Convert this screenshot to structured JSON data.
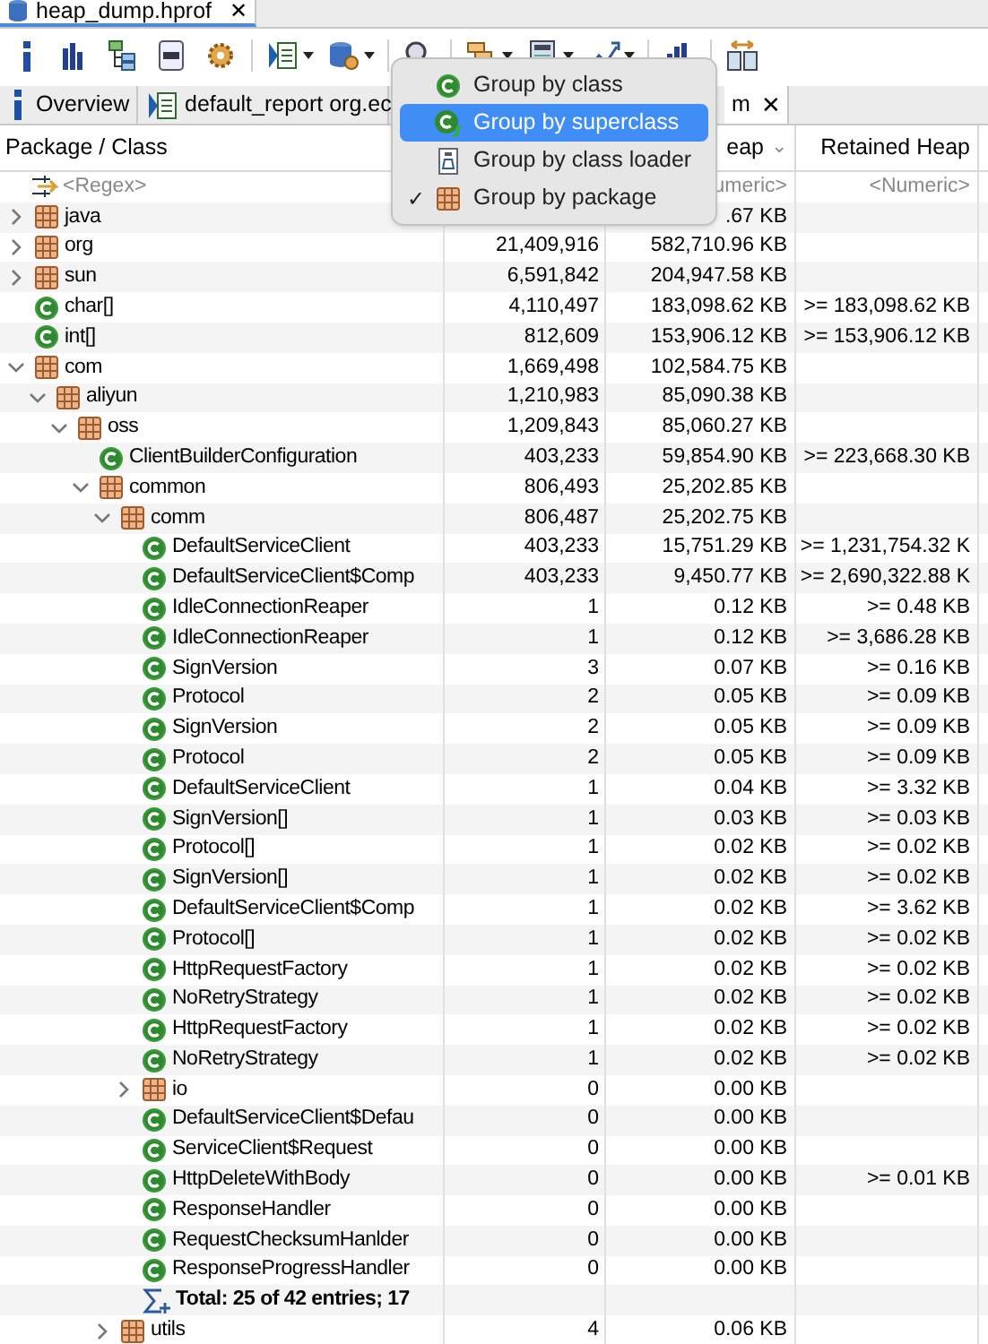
{
  "editor_tab": {
    "title": "heap_dump.hprof",
    "close": "✕"
  },
  "toolbar": [
    {
      "kind": "info",
      "dropdown": false
    },
    {
      "kind": "histogram",
      "dropdown": false
    },
    {
      "kind": "tree",
      "dropdown": false
    },
    {
      "kind": "oql",
      "dropdown": false
    },
    {
      "kind": "gears",
      "dropdown": false
    },
    {
      "kind": "report",
      "dropdown": true
    },
    {
      "kind": "dbgear",
      "dropdown": true
    },
    {
      "kind": "search",
      "dropdown": false
    },
    {
      "kind": "group",
      "dropdown": true
    },
    {
      "kind": "calc",
      "dropdown": true
    },
    {
      "kind": "export",
      "dropdown": true
    },
    {
      "kind": "chart",
      "dropdown": false
    },
    {
      "kind": "compare",
      "dropdown": false
    }
  ],
  "tabs": [
    {
      "kind": "info",
      "label": "Overview",
      "selected": false
    },
    {
      "kind": "report",
      "label": "default_report org.ec",
      "selected": false
    },
    {
      "kind": "none",
      "label": "m",
      "selected": true,
      "close": "✕"
    }
  ],
  "columns": [
    {
      "label": "Package / Class"
    },
    {
      "label": "eap",
      "sort": "⌄"
    },
    {
      "label": "Retained Heap"
    }
  ],
  "filter": {
    "name": "<Regex>",
    "shallow": "umeric>",
    "retained": "<Numeric>"
  },
  "rows": [
    {
      "kind": "package",
      "name": "java",
      "expanded": false,
      "shallow": ".67 KB"
    },
    {
      "kind": "package",
      "name": "org",
      "expanded": false,
      "objects": "21,409,916",
      "shallow": "582,710.96 KB"
    },
    {
      "kind": "package",
      "name": "sun",
      "expanded": false,
      "objects": "6,591,842",
      "shallow": "204,947.58 KB"
    },
    {
      "kind": "class",
      "name": "char[]",
      "objects": "4,110,497",
      "shallow": "183,098.62 KB",
      "retained": ">= 183,098.62 KB"
    },
    {
      "kind": "class",
      "name": "int[]",
      "objects": "812,609",
      "shallow": "153,906.12 KB",
      "retained": ">= 153,906.12 KB"
    },
    {
      "kind": "package",
      "name": "com",
      "expanded": true,
      "objects": "1,669,498",
      "shallow": "102,584.75 KB",
      "children": [
        {
          "kind": "package",
          "name": "aliyun",
          "expanded": true,
          "objects": "1,210,983",
          "shallow": "85,090.38 KB",
          "children": [
            {
              "kind": "package",
              "name": "oss",
              "expanded": true,
              "objects": "1,209,843",
              "shallow": "85,060.27 KB",
              "children": [
                {
                  "kind": "class",
                  "name": "ClientBuilderConfiguration",
                  "objects": "403,233",
                  "shallow": "59,854.90 KB",
                  "retained": ">= 223,668.30 KB"
                },
                {
                  "kind": "package",
                  "name": "common",
                  "expanded": true,
                  "objects": "806,493",
                  "shallow": "25,202.85 KB",
                  "children": [
                    {
                      "kind": "package",
                      "name": "comm",
                      "expanded": true,
                      "objects": "806,487",
                      "shallow": "25,202.75 KB",
                      "children": [
                        {
                          "kind": "class",
                          "name": "DefaultServiceClient",
                          "objects": "403,233",
                          "shallow": "15,751.29 KB",
                          "retained": ">= 1,231,754.32 K"
                        },
                        {
                          "kind": "class",
                          "name": "DefaultServiceClient$Comp",
                          "objects": "403,233",
                          "shallow": "9,450.77 KB",
                          "retained": ">= 2,690,322.88 K"
                        },
                        {
                          "kind": "class",
                          "name": "IdleConnectionReaper",
                          "objects": "1",
                          "shallow": "0.12 KB",
                          "retained": ">= 0.48 KB"
                        },
                        {
                          "kind": "class",
                          "name": "IdleConnectionReaper",
                          "objects": "1",
                          "shallow": "0.12 KB",
                          "retained": ">= 3,686.28 KB"
                        },
                        {
                          "kind": "class",
                          "name": "SignVersion",
                          "objects": "3",
                          "shallow": "0.07 KB",
                          "retained": ">= 0.16 KB"
                        },
                        {
                          "kind": "class",
                          "name": "Protocol",
                          "objects": "2",
                          "shallow": "0.05 KB",
                          "retained": ">= 0.09 KB"
                        },
                        {
                          "kind": "class",
                          "name": "SignVersion",
                          "objects": "2",
                          "shallow": "0.05 KB",
                          "retained": ">= 0.09 KB"
                        },
                        {
                          "kind": "class",
                          "name": "Protocol",
                          "objects": "2",
                          "shallow": "0.05 KB",
                          "retained": ">= 0.09 KB"
                        },
                        {
                          "kind": "class",
                          "name": "DefaultServiceClient",
                          "objects": "1",
                          "shallow": "0.04 KB",
                          "retained": ">= 3.32 KB"
                        },
                        {
                          "kind": "class",
                          "name": "SignVersion[]",
                          "objects": "1",
                          "shallow": "0.03 KB",
                          "retained": ">= 0.03 KB"
                        },
                        {
                          "kind": "class",
                          "name": "Protocol[]",
                          "objects": "1",
                          "shallow": "0.02 KB",
                          "retained": ">= 0.02 KB"
                        },
                        {
                          "kind": "class",
                          "name": "SignVersion[]",
                          "objects": "1",
                          "shallow": "0.02 KB",
                          "retained": ">= 0.02 KB"
                        },
                        {
                          "kind": "class",
                          "name": "DefaultServiceClient$Comp",
                          "objects": "1",
                          "shallow": "0.02 KB",
                          "retained": ">= 3.62 KB"
                        },
                        {
                          "kind": "class",
                          "name": "Protocol[]",
                          "objects": "1",
                          "shallow": "0.02 KB",
                          "retained": ">= 0.02 KB"
                        },
                        {
                          "kind": "class",
                          "name": "HttpRequestFactory",
                          "objects": "1",
                          "shallow": "0.02 KB",
                          "retained": ">= 0.02 KB"
                        },
                        {
                          "kind": "class",
                          "name": "NoRetryStrategy",
                          "objects": "1",
                          "shallow": "0.02 KB",
                          "retained": ">= 0.02 KB"
                        },
                        {
                          "kind": "class",
                          "name": "HttpRequestFactory",
                          "objects": "1",
                          "shallow": "0.02 KB",
                          "retained": ">= 0.02 KB"
                        },
                        {
                          "kind": "class",
                          "name": "NoRetryStrategy",
                          "objects": "1",
                          "shallow": "0.02 KB",
                          "retained": ">= 0.02 KB"
                        },
                        {
                          "kind": "package",
                          "name": "io",
                          "expanded": false,
                          "objects": "0",
                          "shallow": "0.00 KB"
                        },
                        {
                          "kind": "class",
                          "name": "DefaultServiceClient$Defau",
                          "objects": "0",
                          "shallow": "0.00 KB"
                        },
                        {
                          "kind": "class",
                          "name": "ServiceClient$Request",
                          "objects": "0",
                          "shallow": "0.00 KB"
                        },
                        {
                          "kind": "class",
                          "name": "HttpDeleteWithBody",
                          "objects": "0",
                          "shallow": "0.00 KB",
                          "retained": ">= 0.01 KB"
                        },
                        {
                          "kind": "class",
                          "name": "ResponseHandler",
                          "objects": "0",
                          "shallow": "0.00 KB"
                        },
                        {
                          "kind": "class",
                          "name": "RequestChecksumHanlder",
                          "objects": "0",
                          "shallow": "0.00 KB"
                        },
                        {
                          "kind": "class",
                          "name": "ResponseProgressHandler",
                          "objects": "0",
                          "shallow": "0.00 KB"
                        },
                        {
                          "kind": "total",
                          "name": "Total: 25 of 42 entries; 17"
                        }
                      ]
                    },
                    {
                      "kind": "package",
                      "name": "utils",
                      "expanded": false,
                      "objects": "4",
                      "shallow": "0.06 KB"
                    }
                  ]
                }
              ]
            }
          ]
        }
      ]
    }
  ],
  "menu": [
    {
      "kind": "class",
      "label": "Group by class",
      "selected": false,
      "checked": false
    },
    {
      "kind": "superclass",
      "label": "Group by superclass",
      "selected": true,
      "checked": false
    },
    {
      "kind": "classloader",
      "label": "Group by class loader",
      "selected": false,
      "checked": false
    },
    {
      "kind": "package",
      "label": "Group by package",
      "selected": false,
      "checked": true
    }
  ],
  "check_mark": "✓"
}
